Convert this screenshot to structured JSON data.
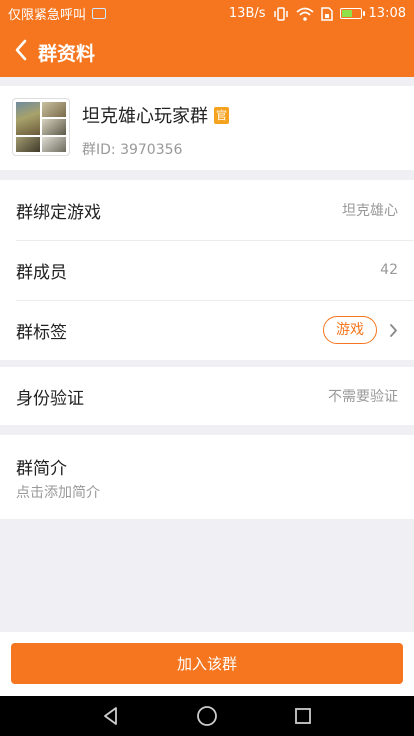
{
  "status_bar": {
    "carrier_text": "仅限紧急呼叫",
    "net_speed": "13B/s",
    "time": "13:08",
    "icons": [
      "image-icon",
      "vibrate-icon",
      "wifi-icon",
      "sim-icon",
      "battery-icon"
    ]
  },
  "header": {
    "title": "群资料",
    "back_icon": "chevron-left-icon",
    "background": "#f5761f"
  },
  "group": {
    "name": "坦克雄心玩家群",
    "official_badge": "官",
    "id_text": "群ID: 3970356"
  },
  "info_rows": [
    {
      "label": "群绑定游戏",
      "value": "坦克雄心"
    },
    {
      "label": "群成员",
      "value": "42"
    },
    {
      "label": "群标签",
      "tag": "游戏"
    }
  ],
  "verification": {
    "label": "身份验证",
    "value": "不需要验证"
  },
  "intro": {
    "title": "群简介",
    "placeholder": "点击添加简介"
  },
  "join_button": {
    "label": "加入该群"
  },
  "colors": {
    "accent": "#f5761f",
    "secondary_text": "#999999",
    "background": "#efeff4"
  }
}
